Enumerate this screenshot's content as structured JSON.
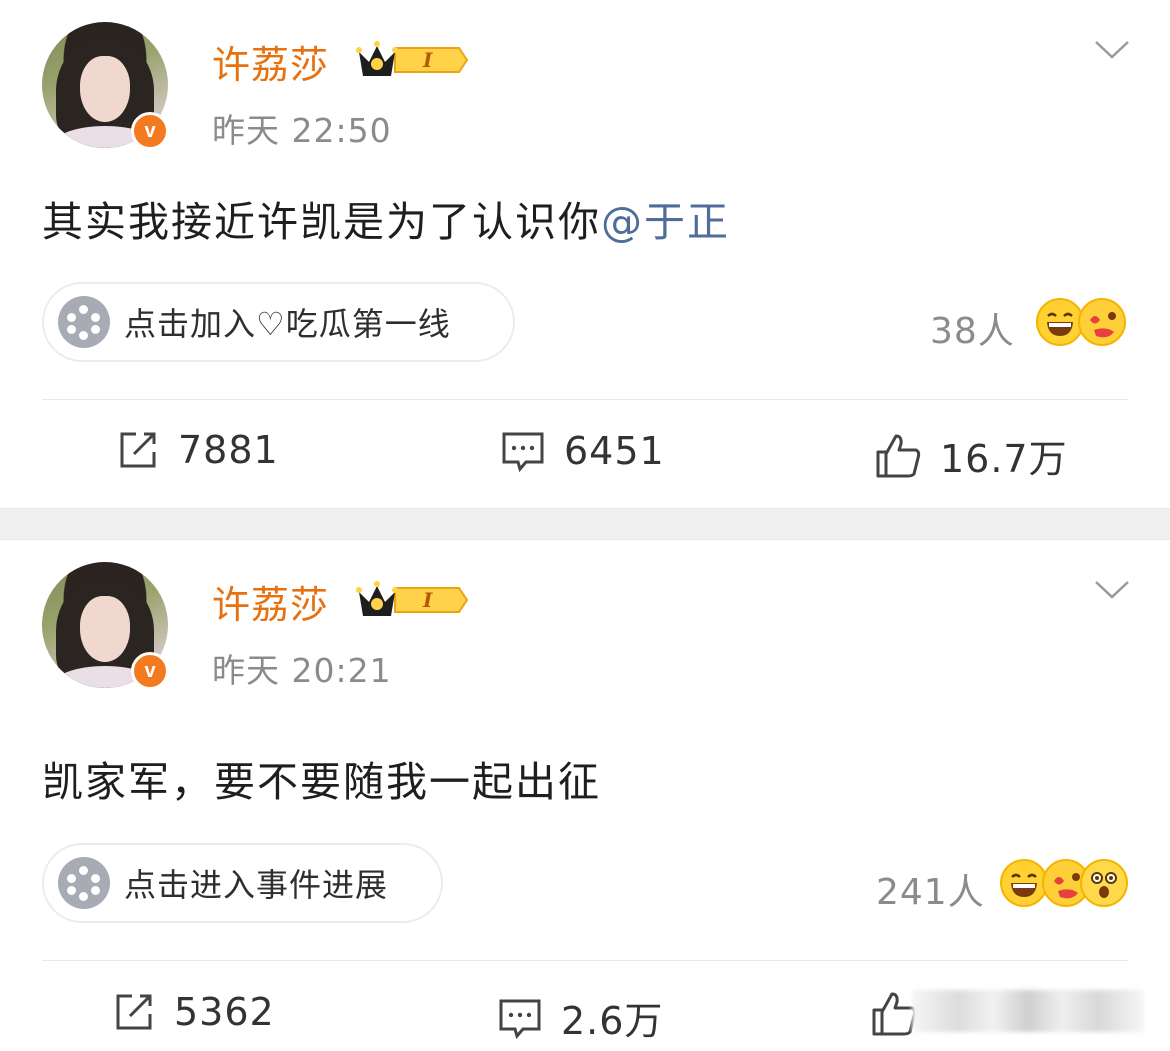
{
  "posts": [
    {
      "author": "许荔莎",
      "time": "昨天 22:50",
      "text": "其实我接近许凯是为了认识你",
      "mention": "@于正",
      "topic": "点击加入♡吃瓜第一线",
      "reactions": "38人",
      "reaction_icons": [
        "grin-emoji-icon",
        "love-face-emoji-icon"
      ],
      "repost": "7881",
      "comments": "6451",
      "likes": "16.7万"
    },
    {
      "author": "许荔莎",
      "time": "昨天 20:21",
      "text": "凯家军，要不要随我一起出征",
      "mention": "",
      "topic": "点击进入事件进展",
      "reactions": "241人",
      "reaction_icons": [
        "grin-emoji-icon",
        "love-face-emoji-icon",
        "shocked-emoji-icon"
      ],
      "repost": "5362",
      "comments": "2.6万",
      "likes": ""
    }
  ],
  "badge": {
    "verified": "v",
    "vip_level": "I"
  },
  "colors": {
    "name": "#e8700e",
    "mention": "#4f6d9a",
    "verified": "#f47a1f",
    "muted": "#8b8b8b"
  }
}
